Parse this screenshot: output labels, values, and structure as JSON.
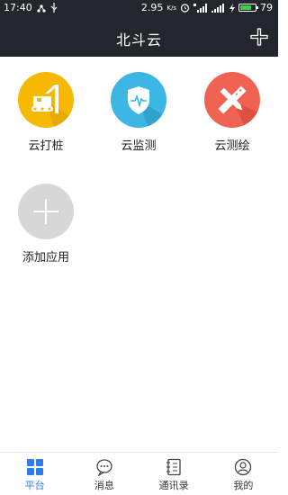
{
  "statusbar": {
    "time": "17:40",
    "speed": "2.95",
    "speed_unit": "K/s",
    "battery": "79",
    "battery_level": 0.79
  },
  "header": {
    "title": "北斗云",
    "add_icon": "plus-icon"
  },
  "apps": [
    {
      "label": "云打桩",
      "icon": "pile-driver-icon",
      "color": "#f6b800"
    },
    {
      "label": "云监测",
      "icon": "shield-pulse-icon",
      "color": "#3cb6e3"
    },
    {
      "label": "云测绘",
      "icon": "ruler-pencil-icon",
      "color": "#f06352"
    },
    {
      "label": "添加应用",
      "icon": "add-icon",
      "color": "#d7d7d7"
    }
  ],
  "tabs": [
    {
      "label": "平台",
      "icon": "grid-icon",
      "active": true
    },
    {
      "label": "消息",
      "icon": "chat-bubble-icon",
      "active": false
    },
    {
      "label": "通讯录",
      "icon": "contacts-book-icon",
      "active": false
    },
    {
      "label": "我的",
      "icon": "user-icon",
      "active": false
    }
  ],
  "colors": {
    "header_bg": "#23262c",
    "active_tab": "#2f7ee6"
  }
}
